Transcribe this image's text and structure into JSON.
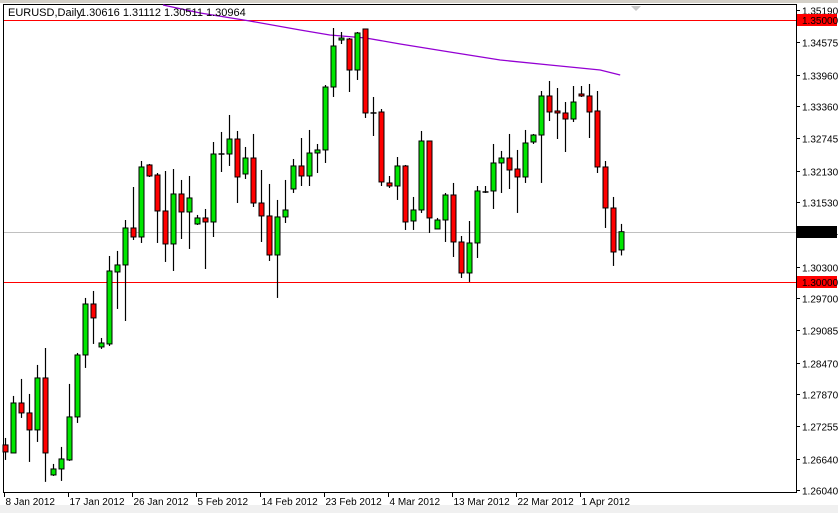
{
  "header": {
    "symbol": "EURUSD,Daily",
    "ohlc": "1.30616 1.31112 1.30511 1.30964"
  },
  "colors": {
    "bull": "#00e600",
    "bear": "#ff0000",
    "ma": "#9400d3",
    "level_line": "#ff0000",
    "bid_line": "#c0c0c0"
  },
  "chart_data": {
    "type": "candlestick",
    "title": "EURUSD,Daily",
    "ylim": [
      1.2604,
      1.3519
    ],
    "grid": false,
    "y_ticks": [
      "1.35190",
      "1.34575",
      "1.33960",
      "1.33360",
      "1.32745",
      "1.32130",
      "1.31530",
      "1.30300",
      "1.29700",
      "1.29085",
      "1.28470",
      "1.27870",
      "1.27255",
      "1.26640",
      "1.26040"
    ],
    "x_ticks": [
      {
        "index": 0,
        "label": "8 Jan 2012"
      },
      {
        "index": 8,
        "label": "17 Jan 2012"
      },
      {
        "index": 16,
        "label": "26 Jan 2012"
      },
      {
        "index": 24,
        "label": "5 Feb 2012"
      },
      {
        "index": 32,
        "label": "14 Feb 2012"
      },
      {
        "index": 40,
        "label": "23 Feb 2012"
      },
      {
        "index": 48,
        "label": "4 Mar 2012"
      },
      {
        "index": 56,
        "label": "13 Mar 2012"
      },
      {
        "index": 64,
        "label": "22 Mar 2012"
      },
      {
        "index": 72,
        "label": "1 Apr 2012"
      }
    ],
    "levels": [
      {
        "price": 1.35,
        "label": "1.35000"
      },
      {
        "price": 1.3,
        "label": "1.30000"
      }
    ],
    "current": {
      "price": 1.30964,
      "label": "1.30964"
    },
    "candles": [
      [
        1.26899,
        1.27032,
        1.26613,
        1.26765
      ],
      [
        1.26746,
        1.27833,
        1.26746,
        1.27699
      ],
      [
        1.27699,
        1.28157,
        1.27414,
        1.27509
      ],
      [
        1.27509,
        1.27871,
        1.26575,
        1.27185
      ],
      [
        1.27185,
        1.28424,
        1.26956,
        1.28176
      ],
      [
        1.28176,
        1.28748,
        1.26194,
        1.26746
      ],
      [
        1.26327,
        1.26537,
        1.26308,
        1.26441
      ],
      [
        1.26441,
        1.26861,
        1.26213,
        1.26632
      ],
      [
        1.26613,
        1.28062,
        1.26594,
        1.27433
      ],
      [
        1.27433,
        1.28652,
        1.27318,
        1.28614
      ],
      [
        1.28614,
        1.29701,
        1.28367,
        1.29586
      ],
      [
        1.29586,
        1.29834,
        1.28824,
        1.2932
      ],
      [
        1.28767,
        1.28938,
        1.28729,
        1.28843
      ],
      [
        1.28824,
        1.30501,
        1.28786,
        1.30215
      ],
      [
        1.30196,
        1.30597,
        1.29491,
        1.3033
      ],
      [
        1.3033,
        1.31187,
        1.29262,
        1.31035
      ],
      [
        1.31035,
        1.31816,
        1.30806,
        1.30863
      ],
      [
        1.30863,
        1.32312,
        1.30749,
        1.32198
      ],
      [
        1.32236,
        1.32255,
        1.32007,
        1.32026
      ],
      [
        1.32045,
        1.32083,
        1.30749,
        1.31359
      ],
      [
        1.31359,
        1.32121,
        1.30387,
        1.3073
      ],
      [
        1.3073,
        1.32159,
        1.30215,
        1.31683
      ],
      [
        1.31683,
        1.3195,
        1.30825,
        1.3134
      ],
      [
        1.3134,
        1.32026,
        1.30635,
        1.31607
      ],
      [
        1.31111,
        1.31283,
        1.31092,
        1.31226
      ],
      [
        1.31226,
        1.31397,
        1.30253,
        1.31149
      ],
      [
        1.31149,
        1.32674,
        1.30863,
        1.32445
      ],
      [
        1.32445,
        1.32865,
        1.32102,
        1.32445
      ],
      [
        1.32445,
        1.33189,
        1.32217,
        1.32731
      ],
      [
        1.32731,
        1.32884,
        1.31511,
        1.32007
      ],
      [
        1.32064,
        1.32579,
        1.31969,
        1.32369
      ],
      [
        1.32369,
        1.32827,
        1.31435,
        1.31511
      ],
      [
        1.31511,
        1.3214,
        1.30768,
        1.31264
      ],
      [
        1.31264,
        1.31874,
        1.30406,
        1.3052
      ],
      [
        1.3052,
        1.31569,
        1.29701,
        1.31245
      ],
      [
        1.31245,
        1.3195,
        1.3113,
        1.31378
      ],
      [
        1.31778,
        1.3235,
        1.31702,
        1.32217
      ],
      [
        1.32217,
        1.3275,
        1.31835,
        1.32026
      ],
      [
        1.32026,
        1.32903,
        1.31835,
        1.32464
      ],
      [
        1.32464,
        1.32636,
        1.32083,
        1.32522
      ],
      [
        1.32522,
        1.3376,
        1.32274,
        1.33722
      ],
      [
        1.33722,
        1.34847,
        1.33532,
        1.34504
      ],
      [
        1.34618,
        1.34771,
        1.34542,
        1.34656
      ],
      [
        1.34637,
        1.34656,
        1.33627,
        1.34046
      ],
      [
        1.34046,
        1.34771,
        1.33856,
        1.34752
      ],
      [
        1.34828,
        1.34828,
        1.33132,
        1.33227
      ],
      [
        1.33227,
        1.33532,
        1.32788,
        1.33227
      ],
      [
        1.33246,
        1.33303,
        1.31835,
        1.31912
      ],
      [
        1.31893,
        1.32026,
        1.31797,
        1.31835
      ],
      [
        1.31835,
        1.32388,
        1.31569,
        1.32217
      ],
      [
        1.32217,
        1.32236,
        1.30997,
        1.31149
      ],
      [
        1.31168,
        1.31626,
        1.30997,
        1.31378
      ],
      [
        1.31378,
        1.32884,
        1.31321,
        1.32693
      ],
      [
        1.32693,
        1.32693,
        1.3094,
        1.31226
      ],
      [
        1.31016,
        1.31226,
        1.31016,
        1.31187
      ],
      [
        1.31187,
        1.31702,
        1.30768,
        1.31664
      ],
      [
        1.31664,
        1.31893,
        1.30482,
        1.30768
      ],
      [
        1.30768,
        1.30882,
        1.30082,
        1.30177
      ],
      [
        1.30177,
        1.31168,
        1.30006,
        1.30749
      ],
      [
        1.30749,
        1.31835,
        1.30463,
        1.3174
      ],
      [
        1.31721,
        1.31835,
        1.31702,
        1.31721
      ],
      [
        1.3174,
        1.32636,
        1.31397,
        1.32274
      ],
      [
        1.32274,
        1.32503,
        1.31702,
        1.32369
      ],
      [
        1.32369,
        1.32827,
        1.31778,
        1.3214
      ],
      [
        1.32159,
        1.32522,
        1.31321,
        1.32007
      ],
      [
        1.32007,
        1.32903,
        1.31893,
        1.32655
      ],
      [
        1.32674,
        1.32827,
        1.32636,
        1.32807
      ],
      [
        1.32807,
        1.33646,
        1.31893,
        1.33551
      ],
      [
        1.33551,
        1.33837,
        1.33074,
        1.33246
      ],
      [
        1.33265,
        1.33703,
        1.32731,
        1.33227
      ],
      [
        1.33227,
        1.33436,
        1.32483,
        1.33112
      ],
      [
        1.33112,
        1.33741,
        1.33055,
        1.33436
      ],
      [
        1.33589,
        1.33741,
        1.33532,
        1.33551
      ],
      [
        1.33551,
        1.3378,
        1.3275,
        1.33246
      ],
      [
        1.33265,
        1.33646,
        1.32083,
        1.32198
      ],
      [
        1.32198,
        1.32312,
        1.31035,
        1.31416
      ],
      [
        1.31416,
        1.31626,
        1.30311,
        1.30577
      ],
      [
        1.30616,
        1.31112,
        1.30511,
        1.30964
      ]
    ],
    "candle_fields": [
      "open",
      "high",
      "low",
      "close"
    ],
    "moving_average": [
      [
        19.75,
        1.35285
      ],
      [
        24.4,
        1.35133
      ],
      [
        30.6,
        1.3498
      ],
      [
        36.9,
        1.34809
      ],
      [
        40.6,
        1.34714
      ],
      [
        45.1,
        1.34656
      ],
      [
        49.4,
        1.34542
      ],
      [
        55.6,
        1.3439
      ],
      [
        61.9,
        1.34237
      ],
      [
        68.1,
        1.34142
      ],
      [
        71.9,
        1.34085
      ],
      [
        74.4,
        1.34046
      ],
      [
        76.9,
        1.33951
      ]
    ]
  }
}
